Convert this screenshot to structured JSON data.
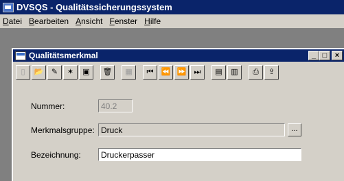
{
  "app": {
    "title": "DVSQS - Qualitätssicherungssystem"
  },
  "menu": [
    "Datei",
    "Bearbeiten",
    "Ansicht",
    "Fenster",
    "Hilfe"
  ],
  "child_window": {
    "title": "Qualitätsmerkmal",
    "minimize": "_",
    "maximize": "□",
    "close": "×"
  },
  "toolbar": {
    "icons": [
      "new-icon",
      "open-icon",
      "edit-icon",
      "magic-wand-icon",
      "copy-icon",
      "delete-icon",
      "disabled-icon",
      "first-record-icon",
      "previous-record-icon",
      "next-record-icon",
      "last-record-icon",
      "list-icon",
      "table-icon",
      "print-icon",
      "export-icon"
    ],
    "glyphs": {
      "new": "▯",
      "open": "📂",
      "edit": "✎",
      "wand": "✶",
      "copy": "▣",
      "delete": "🗑",
      "disabled": "▦",
      "first": "⏮",
      "prev": "⏪",
      "next": "⏩",
      "last": "⏭",
      "list": "▤",
      "table": "▥",
      "print": "⎙",
      "export": "⇪"
    }
  },
  "form": {
    "nummer_label": "Nummer:",
    "nummer_value": "40.2",
    "gruppe_label": "Merkmalsgruppe:",
    "gruppe_value": "Druck",
    "browse_label": "...",
    "bezeichnung_label": "Bezeichnung:",
    "bezeichnung_value": "Druckerpasser"
  }
}
